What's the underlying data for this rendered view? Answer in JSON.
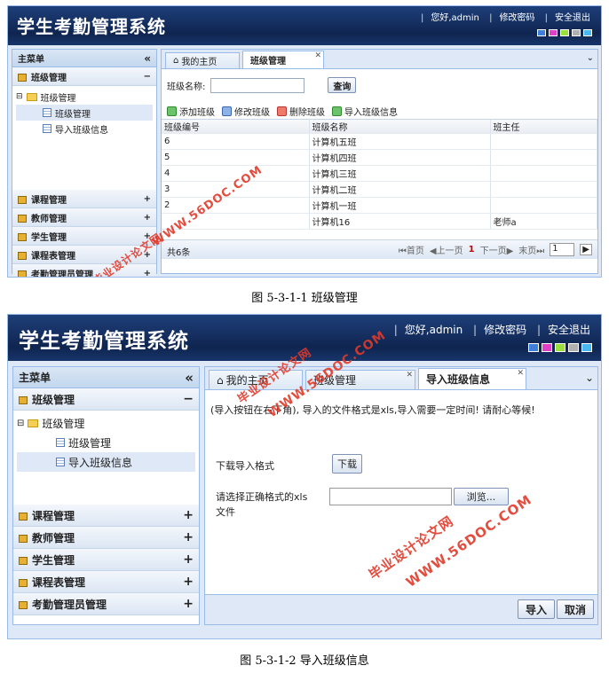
{
  "app_title": "学生考勤管理系统",
  "header_links": [
    "您好,admin",
    "修改密码",
    "安全退出"
  ],
  "theme_colors": [
    "#3f7fd9",
    "#e040c8",
    "#9adf3a",
    "#b0b0b0",
    "#4ab8f0"
  ],
  "menu": {
    "title": "主菜单",
    "collapse_icon": "double-chevron-left-icon",
    "groups": [
      {
        "label": "班级管理",
        "toggle": "−"
      },
      {
        "label": "课程管理",
        "toggle": "+"
      },
      {
        "label": "教师管理",
        "toggle": "+"
      },
      {
        "label": "学生管理",
        "toggle": "+"
      },
      {
        "label": "课程表管理",
        "toggle": "+"
      },
      {
        "label": "考勤管理员管理",
        "toggle": "+"
      }
    ],
    "tree": {
      "root": "班级管理",
      "items": [
        "班级管理",
        "导入班级信息"
      ]
    }
  },
  "screen1": {
    "tabs": [
      {
        "label": "我的主页"
      },
      {
        "label": "班级管理"
      }
    ],
    "search_label": "班级名称:",
    "search_value": "",
    "search_button": "查询",
    "toolbar": [
      "添加班级",
      "修改班级",
      "删除班级",
      "导入班级信息"
    ],
    "columns": [
      "班级编号",
      "班级名称",
      "班主任"
    ],
    "rows": [
      [
        "6",
        "计算机五班",
        ""
      ],
      [
        "5",
        "计算机四班",
        ""
      ],
      [
        "4",
        "计算机三班",
        ""
      ],
      [
        "3",
        "计算机二班",
        ""
      ],
      [
        "2",
        "计算机一班",
        ""
      ],
      [
        "",
        "计算机16",
        "老师a"
      ]
    ],
    "total": "共6条",
    "pager": {
      "first": "首页",
      "prev": "上一页",
      "current": "1",
      "next": "下一页",
      "last": "末页",
      "page_input": "1"
    }
  },
  "caption1": "图 5-3-1-1  班级管理",
  "screen2": {
    "tabs": [
      {
        "label": "我的主页"
      },
      {
        "label": "班级管理"
      },
      {
        "label": "导入班级信息"
      }
    ],
    "notice": "(导入按钮在右下角), 导入的文件格式是xls,导入需要一定时间! 请耐心等候!",
    "download_label": "下载导入格式",
    "download_button": "下载",
    "file_label_1": "请选择正确格式的xls",
    "file_label_2": "文件",
    "browse_button": "浏览...",
    "import_button": "导入",
    "cancel_button": "取消"
  },
  "caption2": "图 5-3-1-2  导入班级信息",
  "watermarks": [
    "毕业设计论文网",
    "WWW.56DOC.COM"
  ]
}
